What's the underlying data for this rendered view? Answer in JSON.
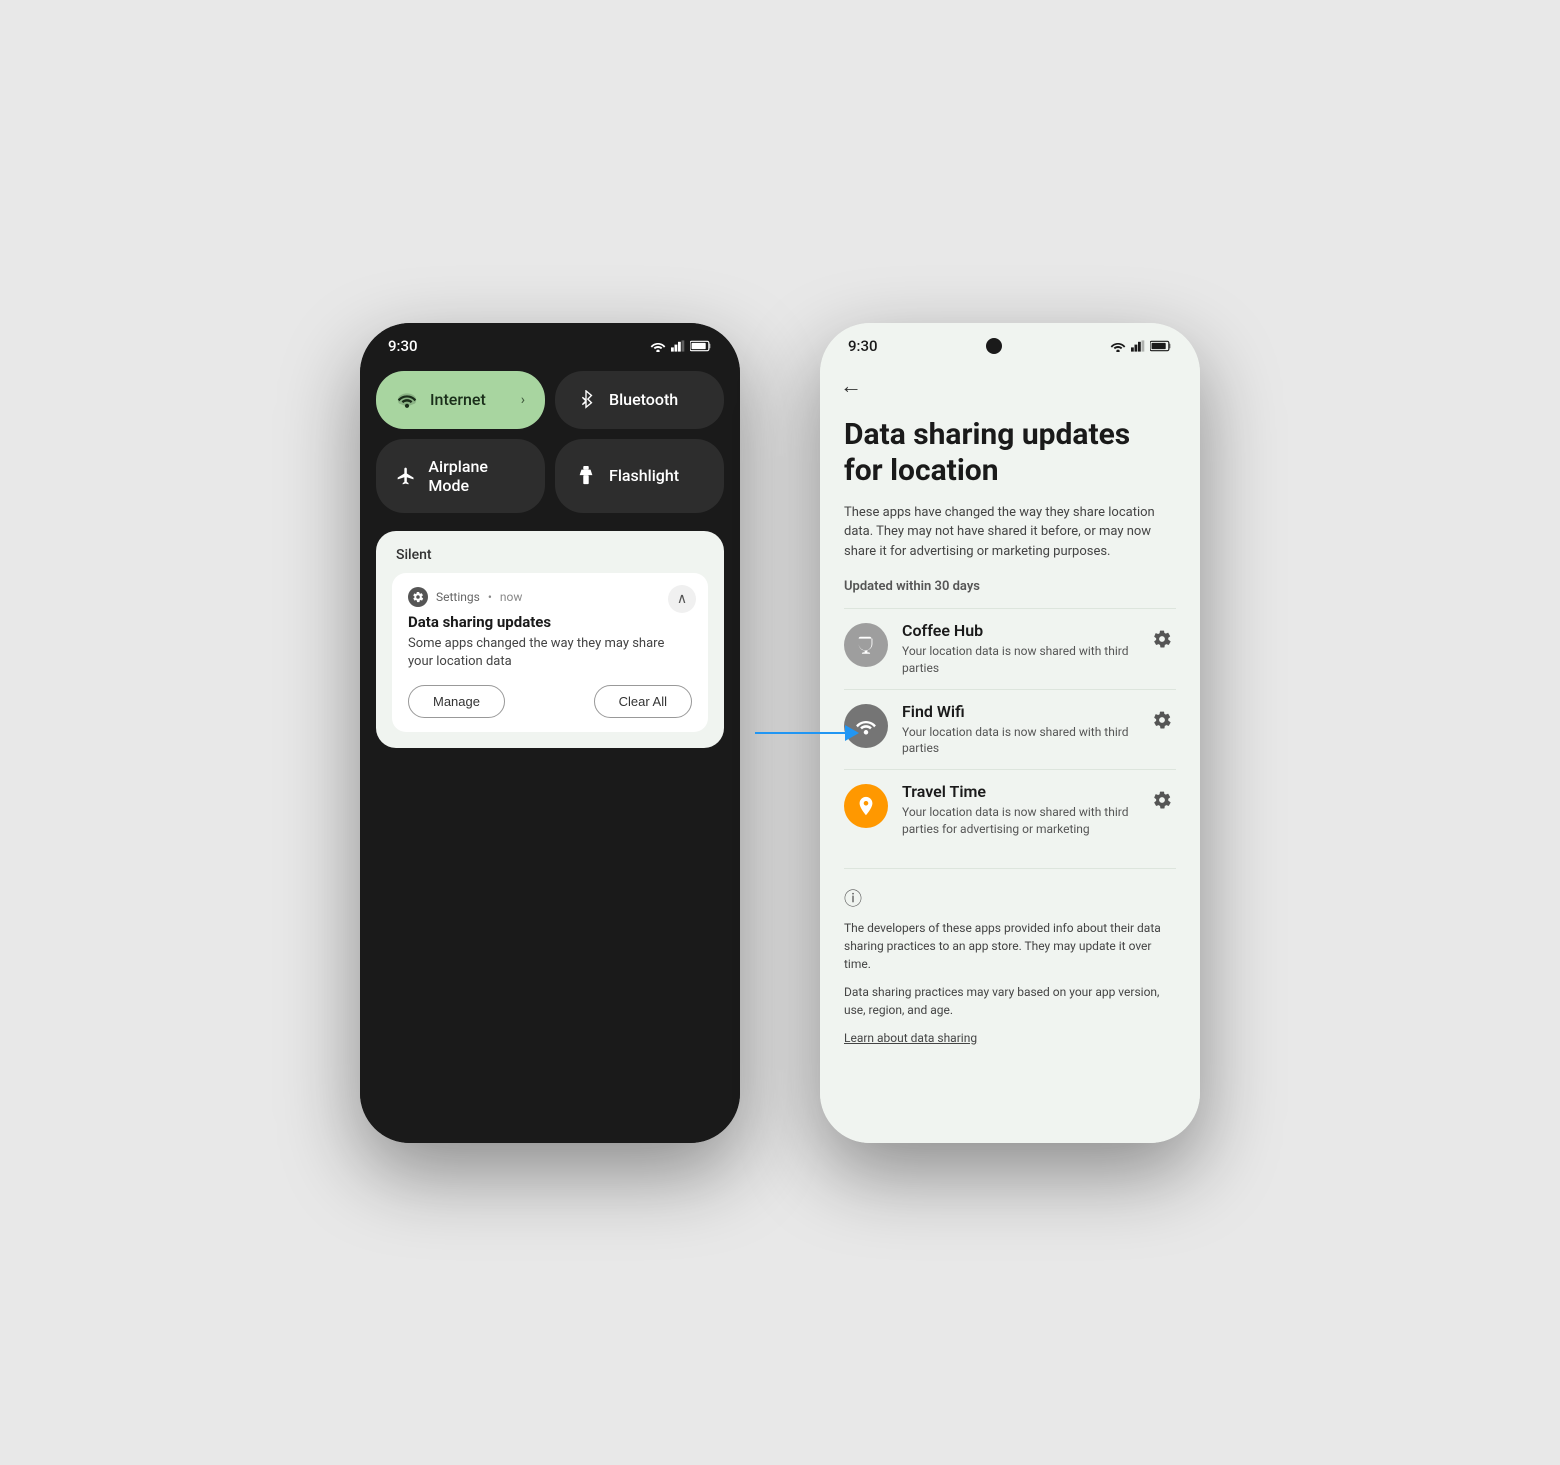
{
  "scene": {
    "background": "#e8e8e8"
  },
  "phone1": {
    "statusBar": {
      "time": "9:30"
    },
    "tiles": [
      {
        "id": "internet",
        "label": "Internet",
        "icon": "wifi",
        "active": true,
        "hasChevron": true
      },
      {
        "id": "bluetooth",
        "label": "Bluetooth",
        "icon": "bluetooth",
        "active": false
      },
      {
        "id": "airplane",
        "label": "Airplane Mode",
        "icon": "airplane",
        "active": false
      },
      {
        "id": "flashlight",
        "label": "Flashlight",
        "icon": "flashlight",
        "active": false
      }
    ],
    "sectionLabel": "Silent",
    "notification": {
      "appName": "Settings",
      "time": "now",
      "title": "Data sharing updates",
      "body": "Some apps changed the way they may share your location data",
      "actions": {
        "manage": "Manage",
        "clearAll": "Clear All"
      }
    }
  },
  "phone2": {
    "statusBar": {
      "time": "9:30"
    },
    "pageTitle": "Data sharing updates for location",
    "pageSubtitle": "These apps have changed the way they share location data. They may not have shared it before, or may now share it for advertising or marketing purposes.",
    "sectionLabel": "Updated within 30 days",
    "apps": [
      {
        "name": "Coffee Hub",
        "desc": "Your location data is now shared with third parties",
        "iconColor": "gray",
        "iconSymbol": "☕"
      },
      {
        "name": "Find Wifi",
        "desc": "Your location data is now shared with third parties",
        "iconColor": "darkgray",
        "iconSymbol": "wifi"
      },
      {
        "name": "Travel Time",
        "desc": "Your location data is now shared with third parties for advertising or marketing",
        "iconColor": "orange",
        "iconSymbol": "🧭"
      }
    ],
    "infoText1": "The developers of these apps provided info about their data sharing practices to an app store. They may update it over time.",
    "infoText2": "Data sharing practices may vary based on your app version, use, region, and age.",
    "learnLink": "Learn about data sharing"
  }
}
